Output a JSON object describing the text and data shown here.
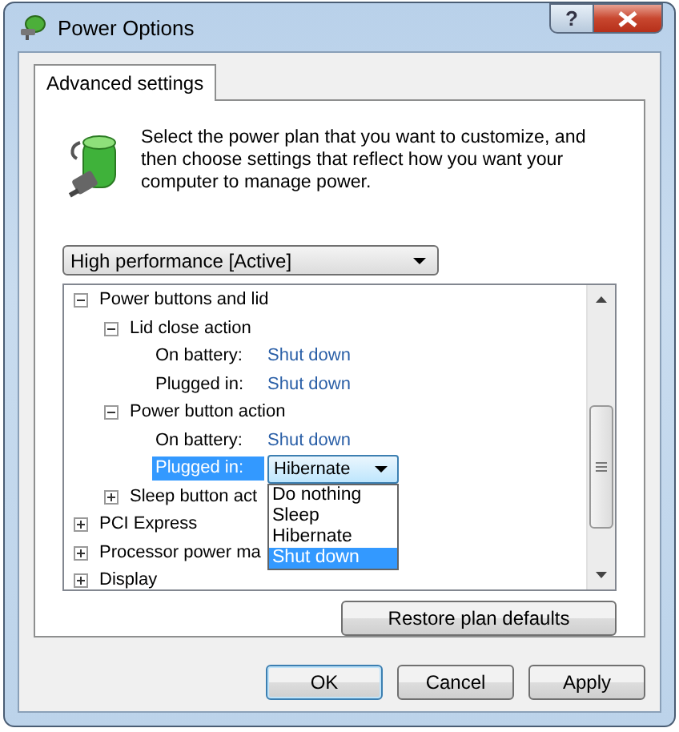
{
  "window": {
    "title": "Power Options",
    "help_label": "?"
  },
  "tabs": [
    {
      "label": "Advanced settings",
      "selected": true
    }
  ],
  "description": "Select the power plan that you want to customize, and then choose settings that reflect how you want your computer to manage power.",
  "plan_select": {
    "value": "High performance [Active]"
  },
  "tree": [
    {
      "label": "Power buttons and lid",
      "expanded": true,
      "children": [
        {
          "label": "Lid close action",
          "expanded": true,
          "settings": [
            {
              "label": "On battery:",
              "value": "Shut down",
              "kind": "link",
              "selected": false
            },
            {
              "label": "Plugged in:",
              "value": "Shut down",
              "kind": "link",
              "selected": false
            }
          ]
        },
        {
          "label": "Power button action",
          "expanded": true,
          "settings": [
            {
              "label": "On battery:",
              "value": "Shut down",
              "kind": "link",
              "selected": false
            },
            {
              "label": "Plugged in:",
              "value": "Hibernate",
              "kind": "dropdown",
              "selected": true,
              "open": true,
              "options": [
                {
                  "label": "Do nothing",
                  "highlighted": false
                },
                {
                  "label": "Sleep",
                  "highlighted": false
                },
                {
                  "label": "Hibernate",
                  "highlighted": false
                },
                {
                  "label": "Shut down",
                  "highlighted": true
                }
              ]
            }
          ]
        },
        {
          "label": "Sleep button act",
          "expanded": false
        }
      ]
    },
    {
      "label": "PCI Express",
      "expanded": false
    },
    {
      "label": "Processor power ma",
      "expanded": false
    },
    {
      "label": "Display",
      "expanded": false
    }
  ],
  "restore_button": "Restore plan defaults",
  "buttons": [
    {
      "label": "OK",
      "default": true
    },
    {
      "label": "Cancel",
      "default": false
    },
    {
      "label": "Apply",
      "default": false
    }
  ]
}
